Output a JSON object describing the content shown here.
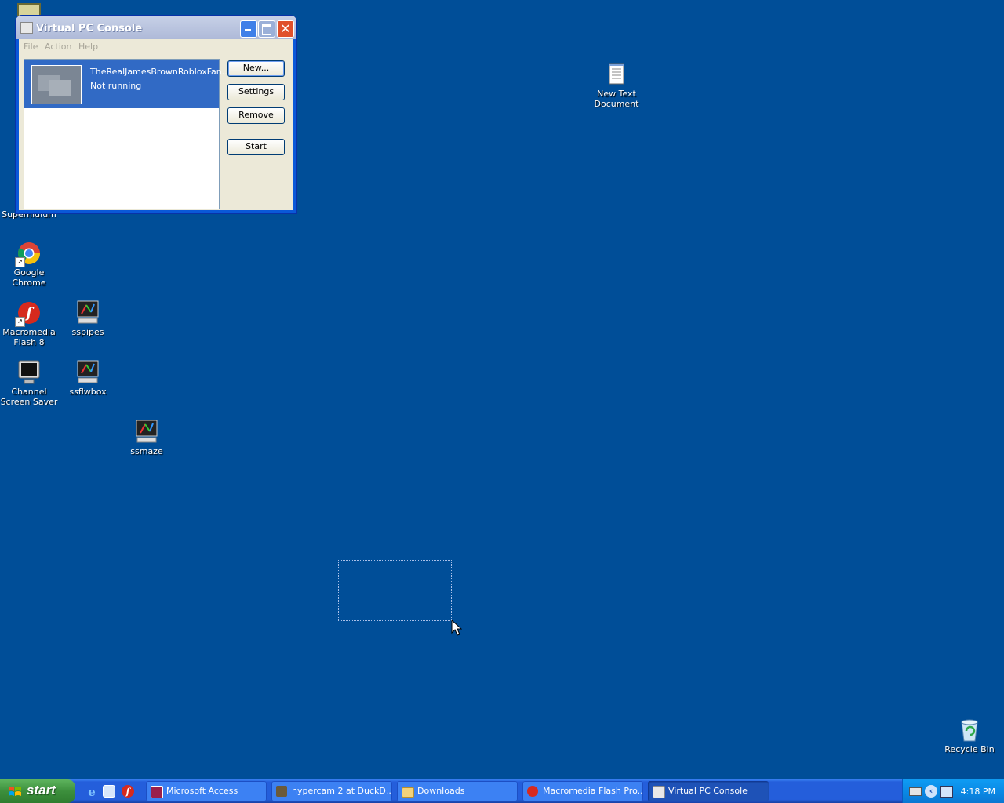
{
  "desktop": {
    "background_color": "#004e98",
    "icons": {
      "superhidden": "Superhidium",
      "chrome": "Google Chrome",
      "flash": "Macromedia Flash 8",
      "sspipes": "sspipes",
      "channel": "Channel Screen Saver",
      "ssflwbox": "ssflwbox",
      "ssmaze": "ssmaze",
      "textdoc": "New Text Document",
      "recycle": "Recycle Bin"
    }
  },
  "window": {
    "title": "Virtual PC Console",
    "menu": [
      "File",
      "Action",
      "Help"
    ],
    "vm": {
      "name": "TheRealJamesBrownRobloxFan...",
      "status": "Not running"
    },
    "buttons": {
      "new": "New...",
      "settings": "Settings",
      "remove": "Remove",
      "start": "Start"
    }
  },
  "taskbar": {
    "start_label": "start",
    "tasks": [
      {
        "label": "Microsoft Access",
        "icon": "access-icon"
      },
      {
        "label": "hypercam 2 at DuckD...",
        "icon": "hypercam-icon"
      },
      {
        "label": "Downloads",
        "icon": "folder-icon"
      },
      {
        "label": "Macromedia Flash Pro...",
        "icon": "flash-icon"
      },
      {
        "label": "Virtual PC Console",
        "icon": "virtualpc-icon"
      }
    ],
    "clock": "4:18 PM"
  }
}
